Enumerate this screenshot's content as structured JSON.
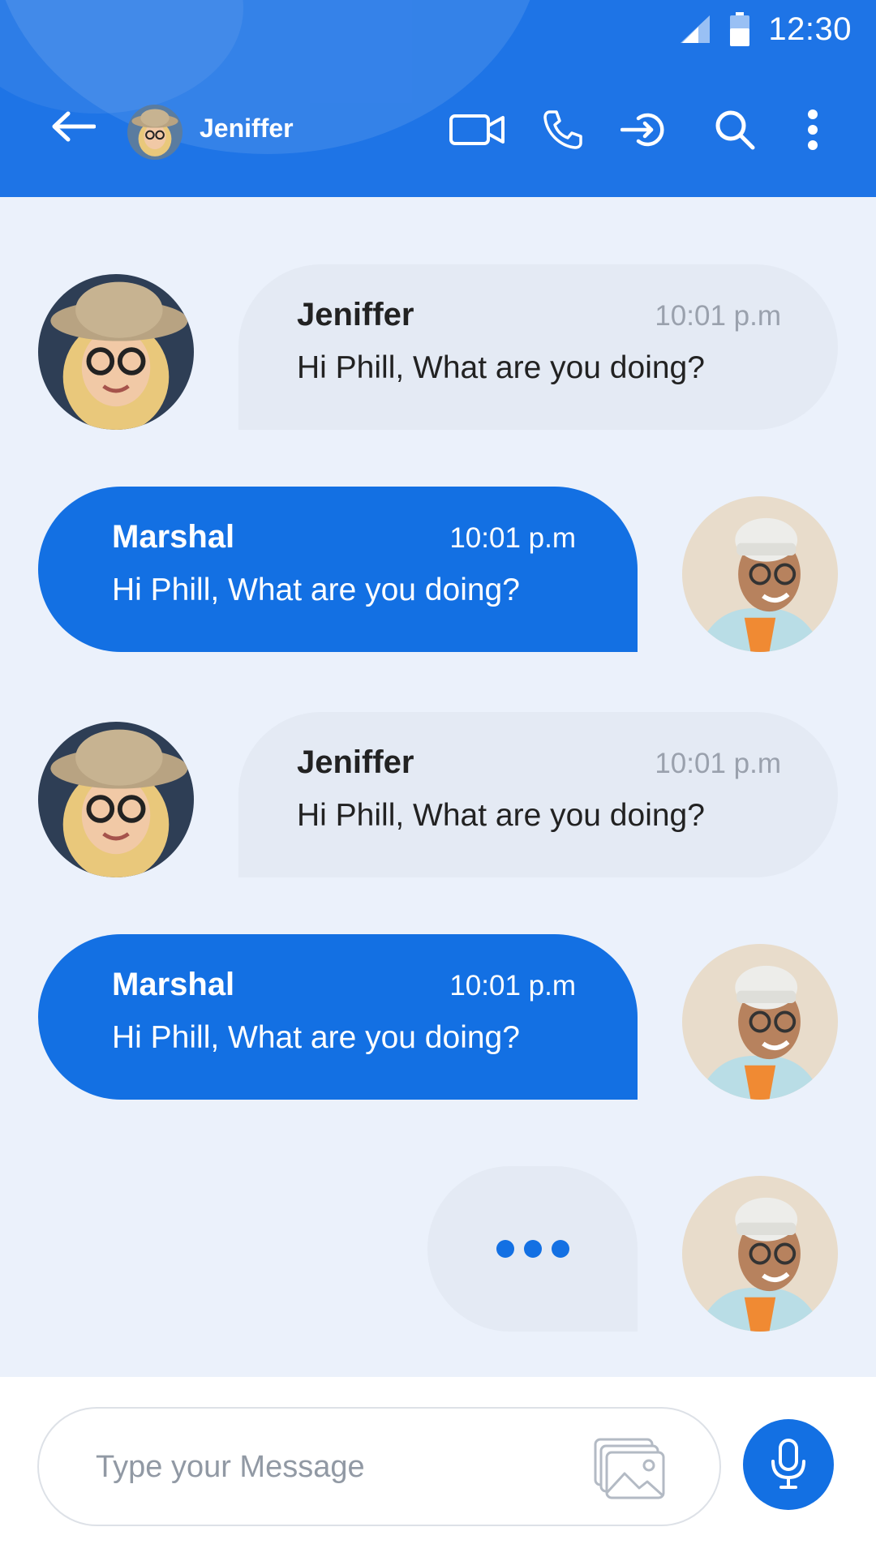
{
  "status_bar": {
    "time": "12:30",
    "icons": [
      "signal-icon",
      "battery-icon"
    ]
  },
  "header": {
    "back_icon": "arrow-left-icon",
    "contact_name": "Jeniffer",
    "actions": [
      "video-call-icon",
      "phone-icon",
      "logout-icon",
      "search-icon",
      "more-vertical-icon"
    ]
  },
  "messages": [
    {
      "sender": "Jeniffer",
      "time": "10:01 p.m",
      "text": "Hi Phill, What are you doing?",
      "direction": "incoming"
    },
    {
      "sender": "Marshal",
      "time": "10:01 p.m",
      "text": "Hi Phill, What are you doing?",
      "direction": "outgoing"
    },
    {
      "sender": "Jeniffer",
      "time": "10:01 p.m",
      "text": "Hi Phill, What are you doing?",
      "direction": "incoming"
    },
    {
      "sender": "Marshal",
      "time": "10:01 p.m",
      "text": "Hi Phill, What are you doing?",
      "direction": "outgoing"
    }
  ],
  "composer": {
    "placeholder": "Type your Message",
    "value": "",
    "gallery_icon": "gallery-icon",
    "mic_icon": "microphone-icon"
  },
  "colors": {
    "primary": "#1370E3",
    "header": "#1E74E6",
    "background": "#EBF1FB",
    "incoming_bubble": "#E4EAF4"
  }
}
